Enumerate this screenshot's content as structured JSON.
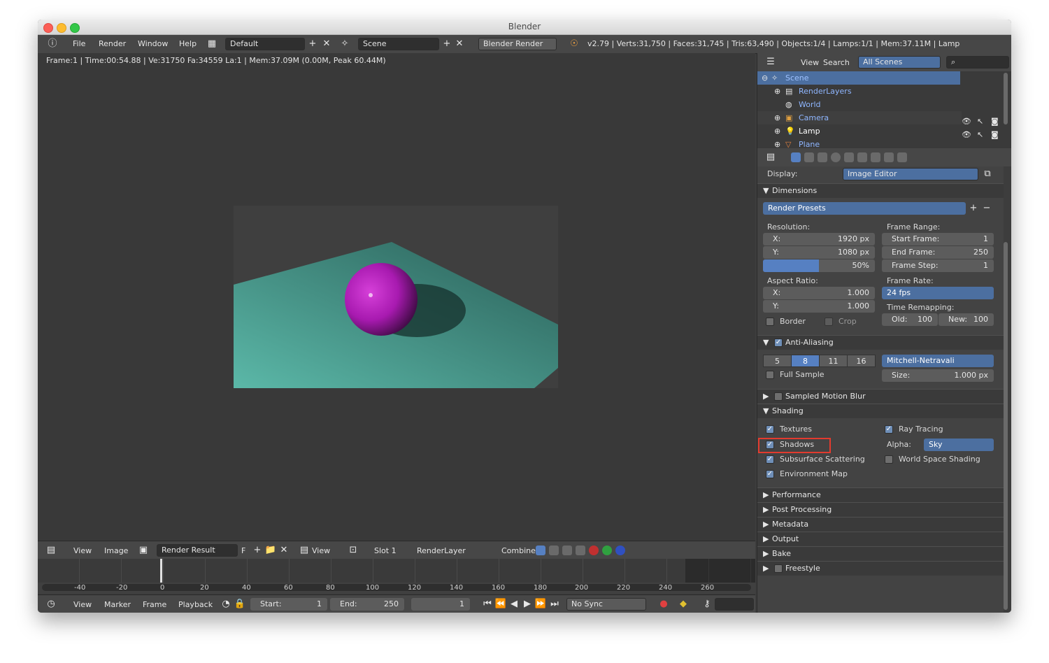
{
  "window": {
    "title": "Blender"
  },
  "menubar": {
    "menus": [
      "File",
      "Render",
      "Window",
      "Help"
    ],
    "layout": "Default",
    "scene": "Scene",
    "engine": "Blender Render",
    "stats": "v2.79 | Verts:31,750 | Faces:31,745 | Tris:63,490 | Objects:1/4 | Lamps:1/1 | Mem:37.11M | Lamp"
  },
  "image_editor": {
    "info": "Frame:1 | Time:00:54.88 | Ve:31750 Fa:34559 La:1 | Mem:37.09M (0.00M, Peak 60.44M)",
    "header": {
      "view": "View",
      "image": "Image",
      "image_name": "Render Result",
      "fake_user": "F",
      "view2": "View",
      "slot": "Slot 1",
      "layer": "RenderLayer",
      "pass": "Combined"
    }
  },
  "timeline": {
    "ticks": [
      "-40",
      "-20",
      "0",
      "20",
      "40",
      "60",
      "80",
      "100",
      "120",
      "140",
      "160",
      "180",
      "200",
      "220",
      "240",
      "260"
    ],
    "menus": [
      "View",
      "Marker",
      "Frame",
      "Playback"
    ],
    "start_label": "Start:",
    "start": "1",
    "end_label": "End:",
    "end": "250",
    "current": "1",
    "sync": "No Sync"
  },
  "outliner": {
    "menus": [
      "View",
      "Search"
    ],
    "filter": "All Scenes",
    "items": [
      {
        "label": "Scene"
      },
      {
        "label": "RenderLayers"
      },
      {
        "label": "World"
      },
      {
        "label": "Camera"
      },
      {
        "label": "Lamp"
      },
      {
        "label": "Plane"
      }
    ]
  },
  "properties": {
    "display_label": "Display:",
    "display_value": "Image Editor",
    "dimensions": {
      "title": "Dimensions",
      "presets": "Render Presets",
      "resolution_label": "Resolution:",
      "res_x_label": "X:",
      "res_x": "1920 px",
      "res_y_label": "Y:",
      "res_y": "1080 px",
      "res_percent": "50%",
      "res_percent_value": 0.5,
      "aspect_label": "Aspect Ratio:",
      "asp_x_label": "X:",
      "asp_x": "1.000",
      "asp_y_label": "Y:",
      "asp_y": "1.000",
      "border": "Border",
      "crop": "Crop",
      "frame_range_label": "Frame Range:",
      "start_frame_label": "Start Frame:",
      "start_frame": "1",
      "end_frame_label": "End Frame:",
      "end_frame": "250",
      "frame_step_label": "Frame Step:",
      "frame_step": "1",
      "frame_rate_label": "Frame Rate:",
      "frame_rate": "24 fps",
      "time_remap_label": "Time Remapping:",
      "old_label": "Old:",
      "old": "100",
      "new_label": "New:",
      "new": "100"
    },
    "anti_aliasing": {
      "title": "Anti-Aliasing",
      "samples": [
        "5",
        "8",
        "11",
        "16"
      ],
      "selected": "8",
      "filter": "Mitchell-Netravali",
      "full_sample": "Full Sample",
      "size_label": "Size:",
      "size": "1.000 px"
    },
    "motion_blur": {
      "title": "Sampled Motion Blur"
    },
    "shading": {
      "title": "Shading",
      "textures": "Textures",
      "shadows": "Shadows",
      "sss": "Subsurface Scattering",
      "env_map": "Environment Map",
      "ray_tracing": "Ray Tracing",
      "alpha_label": "Alpha:",
      "alpha": "Sky",
      "world_space": "World Space Shading"
    },
    "collapsed": [
      "Performance",
      "Post Processing",
      "Metadata",
      "Output",
      "Bake",
      "Freestyle"
    ]
  },
  "colors": {
    "accent": "#4c6fa0",
    "highlight": "#e33b2e",
    "sphere": "#c020c8",
    "plane": "#5ab8a6"
  }
}
